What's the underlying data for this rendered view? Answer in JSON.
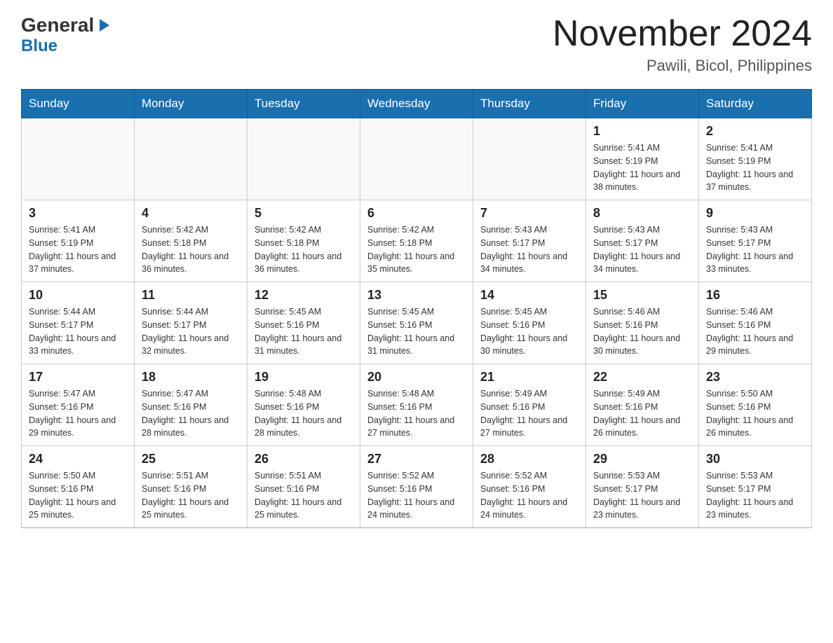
{
  "header": {
    "logo_general": "General",
    "logo_blue": "Blue",
    "month_title": "November 2024",
    "location": "Pawili, Bicol, Philippines"
  },
  "weekdays": [
    "Sunday",
    "Monday",
    "Tuesday",
    "Wednesday",
    "Thursday",
    "Friday",
    "Saturday"
  ],
  "weeks": [
    {
      "days": [
        {
          "date": "",
          "sunrise": "",
          "sunset": "",
          "daylight": ""
        },
        {
          "date": "",
          "sunrise": "",
          "sunset": "",
          "daylight": ""
        },
        {
          "date": "",
          "sunrise": "",
          "sunset": "",
          "daylight": ""
        },
        {
          "date": "",
          "sunrise": "",
          "sunset": "",
          "daylight": ""
        },
        {
          "date": "",
          "sunrise": "",
          "sunset": "",
          "daylight": ""
        },
        {
          "date": "1",
          "sunrise": "Sunrise: 5:41 AM",
          "sunset": "Sunset: 5:19 PM",
          "daylight": "Daylight: 11 hours and 38 minutes."
        },
        {
          "date": "2",
          "sunrise": "Sunrise: 5:41 AM",
          "sunset": "Sunset: 5:19 PM",
          "daylight": "Daylight: 11 hours and 37 minutes."
        }
      ]
    },
    {
      "days": [
        {
          "date": "3",
          "sunrise": "Sunrise: 5:41 AM",
          "sunset": "Sunset: 5:19 PM",
          "daylight": "Daylight: 11 hours and 37 minutes."
        },
        {
          "date": "4",
          "sunrise": "Sunrise: 5:42 AM",
          "sunset": "Sunset: 5:18 PM",
          "daylight": "Daylight: 11 hours and 36 minutes."
        },
        {
          "date": "5",
          "sunrise": "Sunrise: 5:42 AM",
          "sunset": "Sunset: 5:18 PM",
          "daylight": "Daylight: 11 hours and 36 minutes."
        },
        {
          "date": "6",
          "sunrise": "Sunrise: 5:42 AM",
          "sunset": "Sunset: 5:18 PM",
          "daylight": "Daylight: 11 hours and 35 minutes."
        },
        {
          "date": "7",
          "sunrise": "Sunrise: 5:43 AM",
          "sunset": "Sunset: 5:17 PM",
          "daylight": "Daylight: 11 hours and 34 minutes."
        },
        {
          "date": "8",
          "sunrise": "Sunrise: 5:43 AM",
          "sunset": "Sunset: 5:17 PM",
          "daylight": "Daylight: 11 hours and 34 minutes."
        },
        {
          "date": "9",
          "sunrise": "Sunrise: 5:43 AM",
          "sunset": "Sunset: 5:17 PM",
          "daylight": "Daylight: 11 hours and 33 minutes."
        }
      ]
    },
    {
      "days": [
        {
          "date": "10",
          "sunrise": "Sunrise: 5:44 AM",
          "sunset": "Sunset: 5:17 PM",
          "daylight": "Daylight: 11 hours and 33 minutes."
        },
        {
          "date": "11",
          "sunrise": "Sunrise: 5:44 AM",
          "sunset": "Sunset: 5:17 PM",
          "daylight": "Daylight: 11 hours and 32 minutes."
        },
        {
          "date": "12",
          "sunrise": "Sunrise: 5:45 AM",
          "sunset": "Sunset: 5:16 PM",
          "daylight": "Daylight: 11 hours and 31 minutes."
        },
        {
          "date": "13",
          "sunrise": "Sunrise: 5:45 AM",
          "sunset": "Sunset: 5:16 PM",
          "daylight": "Daylight: 11 hours and 31 minutes."
        },
        {
          "date": "14",
          "sunrise": "Sunrise: 5:45 AM",
          "sunset": "Sunset: 5:16 PM",
          "daylight": "Daylight: 11 hours and 30 minutes."
        },
        {
          "date": "15",
          "sunrise": "Sunrise: 5:46 AM",
          "sunset": "Sunset: 5:16 PM",
          "daylight": "Daylight: 11 hours and 30 minutes."
        },
        {
          "date": "16",
          "sunrise": "Sunrise: 5:46 AM",
          "sunset": "Sunset: 5:16 PM",
          "daylight": "Daylight: 11 hours and 29 minutes."
        }
      ]
    },
    {
      "days": [
        {
          "date": "17",
          "sunrise": "Sunrise: 5:47 AM",
          "sunset": "Sunset: 5:16 PM",
          "daylight": "Daylight: 11 hours and 29 minutes."
        },
        {
          "date": "18",
          "sunrise": "Sunrise: 5:47 AM",
          "sunset": "Sunset: 5:16 PM",
          "daylight": "Daylight: 11 hours and 28 minutes."
        },
        {
          "date": "19",
          "sunrise": "Sunrise: 5:48 AM",
          "sunset": "Sunset: 5:16 PM",
          "daylight": "Daylight: 11 hours and 28 minutes."
        },
        {
          "date": "20",
          "sunrise": "Sunrise: 5:48 AM",
          "sunset": "Sunset: 5:16 PM",
          "daylight": "Daylight: 11 hours and 27 minutes."
        },
        {
          "date": "21",
          "sunrise": "Sunrise: 5:49 AM",
          "sunset": "Sunset: 5:16 PM",
          "daylight": "Daylight: 11 hours and 27 minutes."
        },
        {
          "date": "22",
          "sunrise": "Sunrise: 5:49 AM",
          "sunset": "Sunset: 5:16 PM",
          "daylight": "Daylight: 11 hours and 26 minutes."
        },
        {
          "date": "23",
          "sunrise": "Sunrise: 5:50 AM",
          "sunset": "Sunset: 5:16 PM",
          "daylight": "Daylight: 11 hours and 26 minutes."
        }
      ]
    },
    {
      "days": [
        {
          "date": "24",
          "sunrise": "Sunrise: 5:50 AM",
          "sunset": "Sunset: 5:16 PM",
          "daylight": "Daylight: 11 hours and 25 minutes."
        },
        {
          "date": "25",
          "sunrise": "Sunrise: 5:51 AM",
          "sunset": "Sunset: 5:16 PM",
          "daylight": "Daylight: 11 hours and 25 minutes."
        },
        {
          "date": "26",
          "sunrise": "Sunrise: 5:51 AM",
          "sunset": "Sunset: 5:16 PM",
          "daylight": "Daylight: 11 hours and 25 minutes."
        },
        {
          "date": "27",
          "sunrise": "Sunrise: 5:52 AM",
          "sunset": "Sunset: 5:16 PM",
          "daylight": "Daylight: 11 hours and 24 minutes."
        },
        {
          "date": "28",
          "sunrise": "Sunrise: 5:52 AM",
          "sunset": "Sunset: 5:16 PM",
          "daylight": "Daylight: 11 hours and 24 minutes."
        },
        {
          "date": "29",
          "sunrise": "Sunrise: 5:53 AM",
          "sunset": "Sunset: 5:17 PM",
          "daylight": "Daylight: 11 hours and 23 minutes."
        },
        {
          "date": "30",
          "sunrise": "Sunrise: 5:53 AM",
          "sunset": "Sunset: 5:17 PM",
          "daylight": "Daylight: 11 hours and 23 minutes."
        }
      ]
    }
  ]
}
